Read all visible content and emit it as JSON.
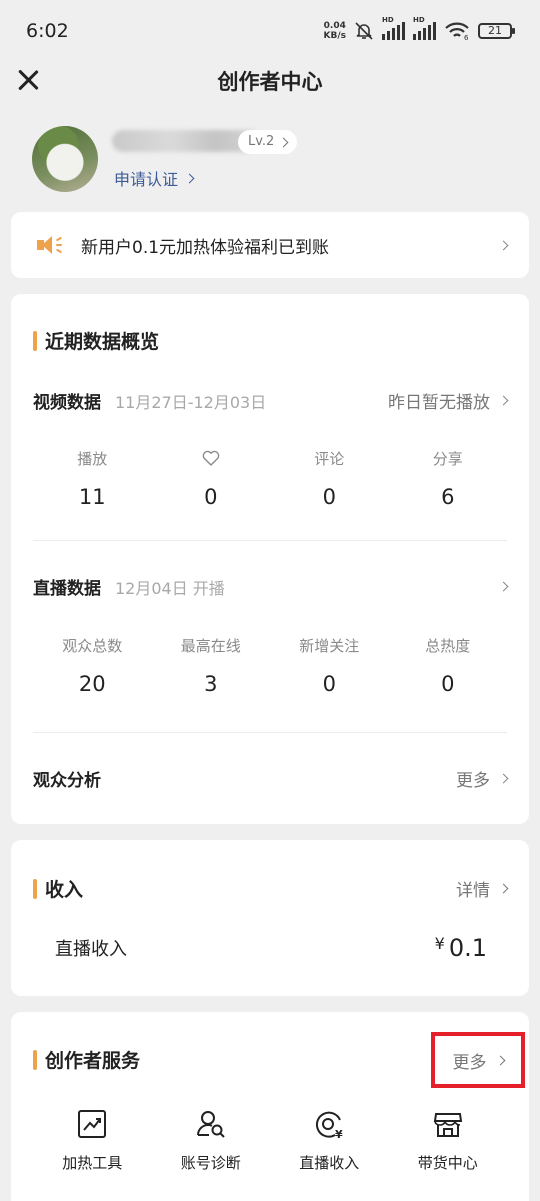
{
  "status_bar": {
    "time": "6:02",
    "net_speed_value": "0.04",
    "net_speed_unit": "KB/s",
    "hd1": "HD",
    "hd2": "HD",
    "wifi_sub": "6",
    "battery": "21"
  },
  "header": {
    "title": "创作者中心"
  },
  "profile": {
    "level": "Lv.2",
    "verify_link": "申请认证"
  },
  "notice": {
    "text": "新用户0.1元加热体验福利已到账"
  },
  "overview": {
    "title": "近期数据概览",
    "video": {
      "label": "视频数据",
      "date_range": "11月27日-12月03日",
      "status": "昨日暂无播放",
      "stats": [
        {
          "label": "播放",
          "value": "11"
        },
        {
          "label": "",
          "icon": "heart-icon",
          "value": "0"
        },
        {
          "label": "评论",
          "value": "0"
        },
        {
          "label": "分享",
          "value": "6"
        }
      ]
    },
    "live": {
      "label": "直播数据",
      "date": "12月04日 开播",
      "stats": [
        {
          "label": "观众总数",
          "value": "20"
        },
        {
          "label": "最高在线",
          "value": "3"
        },
        {
          "label": "新增关注",
          "value": "0"
        },
        {
          "label": "总热度",
          "value": "0"
        }
      ]
    },
    "audience": {
      "label": "观众分析",
      "more": "更多"
    }
  },
  "income": {
    "title": "收入",
    "detail": "详情",
    "row_label": "直播收入",
    "currency": "¥",
    "amount": "0.1"
  },
  "services": {
    "title": "创作者服务",
    "more": "更多",
    "highlight_color": "#e6202a",
    "items": [
      {
        "label": "加热工具",
        "icon": "trend-chart-icon"
      },
      {
        "label": "账号诊断",
        "icon": "user-search-icon"
      },
      {
        "label": "直播收入",
        "icon": "live-income-icon"
      },
      {
        "label": "带货中心",
        "icon": "shop-icon"
      }
    ]
  },
  "colors": {
    "accent": "#f0a24a",
    "link": "#3d5c97",
    "background": "#efefef"
  }
}
